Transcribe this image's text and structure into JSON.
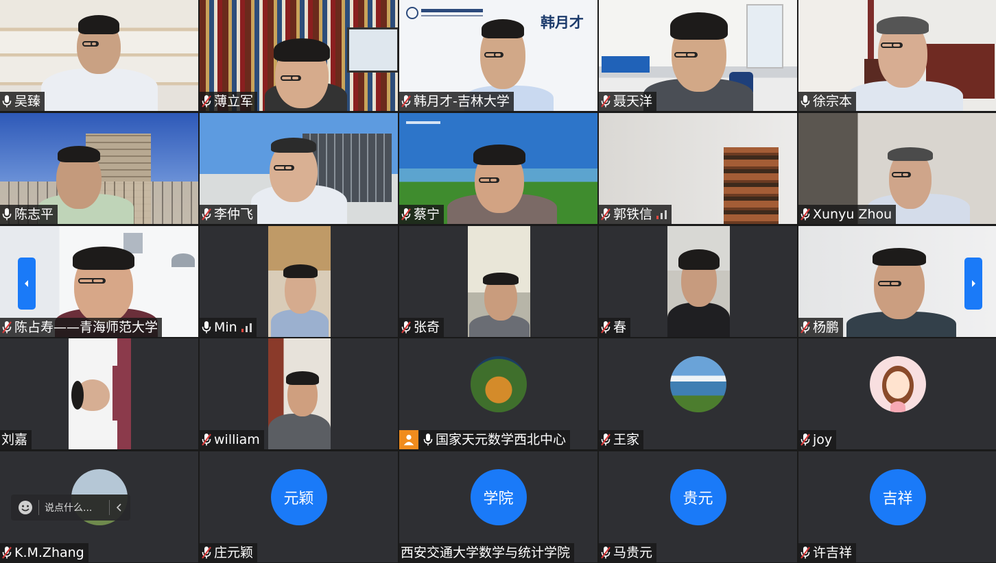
{
  "participants": [
    {
      "name": "吴臻",
      "mic": "on"
    },
    {
      "name": "薄立军",
      "mic": "muted"
    },
    {
      "name": "韩月才-吉林大学",
      "mic": "muted",
      "banner_title": "韩月才"
    },
    {
      "name": "聂天洋",
      "mic": "muted"
    },
    {
      "name": "徐宗本",
      "mic": "on"
    },
    {
      "name": "陈志平",
      "mic": "on"
    },
    {
      "name": "李仲飞",
      "mic": "muted"
    },
    {
      "name": "蔡宁",
      "mic": "muted"
    },
    {
      "name": "郭铁信",
      "mic": "muted"
    },
    {
      "name": "Xunyu Zhou",
      "mic": "muted"
    },
    {
      "name": "陈占寿——青海师范大学",
      "mic": "muted"
    },
    {
      "name": "Min",
      "mic": "on"
    },
    {
      "name": "张奇",
      "mic": "muted"
    },
    {
      "name": "春",
      "mic": "muted"
    },
    {
      "name": "杨鹏",
      "mic": "muted"
    },
    {
      "name": "刘嘉",
      "mic": "none"
    },
    {
      "name": "william",
      "mic": "muted"
    },
    {
      "name": "国家天元数学西北中心",
      "mic": "on"
    },
    {
      "name": "王家",
      "mic": "muted"
    },
    {
      "name": "joy",
      "mic": "muted"
    },
    {
      "name": "K.M.Zhang",
      "mic": "muted"
    },
    {
      "name": "庄元颖",
      "mic": "muted",
      "avatar_text": "元颖"
    },
    {
      "name": "西安交通大学数学与统计学院",
      "mic": "none",
      "avatar_text": "学院"
    },
    {
      "name": "马贵元",
      "mic": "muted",
      "avatar_text": "贵元"
    },
    {
      "name": "许吉祥",
      "mic": "muted",
      "avatar_text": "吉祥"
    }
  ],
  "chat": {
    "placeholder": "说点什么..."
  },
  "colors": {
    "accent": "#1a7af8",
    "tile_bg": "#2e2f33",
    "active_border": "#3fc25a",
    "muted": "#d63a3a"
  },
  "icons": [
    "mic-icon",
    "mic-muted-icon",
    "signal-bars-icon",
    "camera-off-icon",
    "emoji-icon",
    "chevron-left-icon",
    "chevron-right-icon"
  ]
}
